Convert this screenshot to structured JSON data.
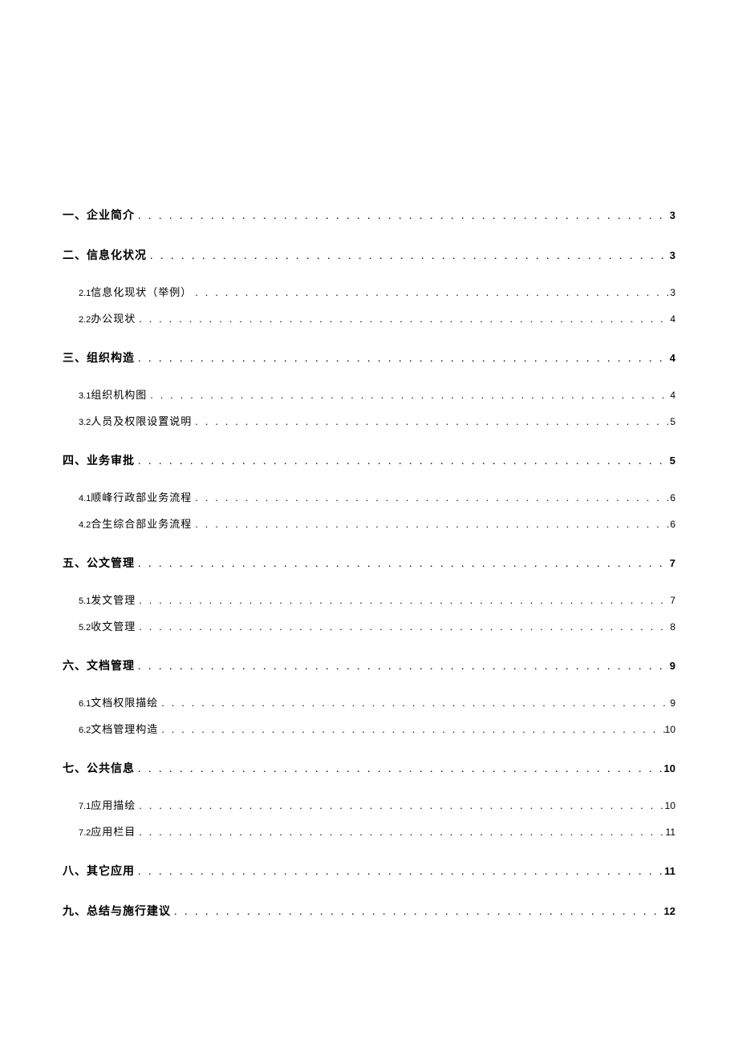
{
  "leader": ". . . . . . . . . . . . . . . . . . . . . . . . . . . . . . . . . . . . . . . . . . . . . . . . . . . . . . . . . . . . . . . . . . . . . . . . . . . . . . . . . . . . . . . . . . . . . . . . . . . . . . . . . . . . . . . . . . . . . . . .",
  "toc": [
    {
      "level": 1,
      "label": "一、企业简介",
      "page": "3"
    },
    {
      "level": 1,
      "label": "二、信息化状况",
      "page": "3"
    },
    {
      "level": 2,
      "idx": "2.1",
      "label": "信息化现状（举例）",
      "page": "3"
    },
    {
      "level": 2,
      "idx": "2.2",
      "label": "办公现状",
      "page": "4"
    },
    {
      "level": 1,
      "label": "三、组织构造",
      "page": "4"
    },
    {
      "level": 2,
      "idx": "3.1",
      "label": "组织机构图",
      "page": "4"
    },
    {
      "level": 2,
      "idx": "3.2",
      "label": "人员及权限设置说明",
      "page": "5"
    },
    {
      "level": 1,
      "label": "四、业务审批",
      "page": "5"
    },
    {
      "level": 2,
      "idx": "4.1",
      "label": "顺峰行政部业务流程",
      "page": "6"
    },
    {
      "level": 2,
      "idx": "4.2",
      "label": "合生综合部业务流程",
      "page": "6"
    },
    {
      "level": 1,
      "label": "五、公文管理",
      "page": "7"
    },
    {
      "level": 2,
      "idx": "5.1",
      "label": "发文管理",
      "page": "7"
    },
    {
      "level": 2,
      "idx": "5.2",
      "label": "收文管理",
      "page": "8"
    },
    {
      "level": 1,
      "label": "六、文档管理",
      "page": "9"
    },
    {
      "level": 2,
      "idx": "6.1",
      "label": "文档权限描绘",
      "page": "9"
    },
    {
      "level": 2,
      "idx": "6.2",
      "label": "文档管理构造",
      "page": "10"
    },
    {
      "level": 1,
      "label": "七、公共信息",
      "page": "10"
    },
    {
      "level": 2,
      "idx": "7.1",
      "label": "应用描绘",
      "page": "10"
    },
    {
      "level": 2,
      "idx": "7.2",
      "label": "应用栏目",
      "page": "11"
    },
    {
      "level": 1,
      "label": "八、其它应用",
      "page": "11"
    },
    {
      "level": 1,
      "label": "九、总结与施行建议",
      "page": "12"
    }
  ]
}
